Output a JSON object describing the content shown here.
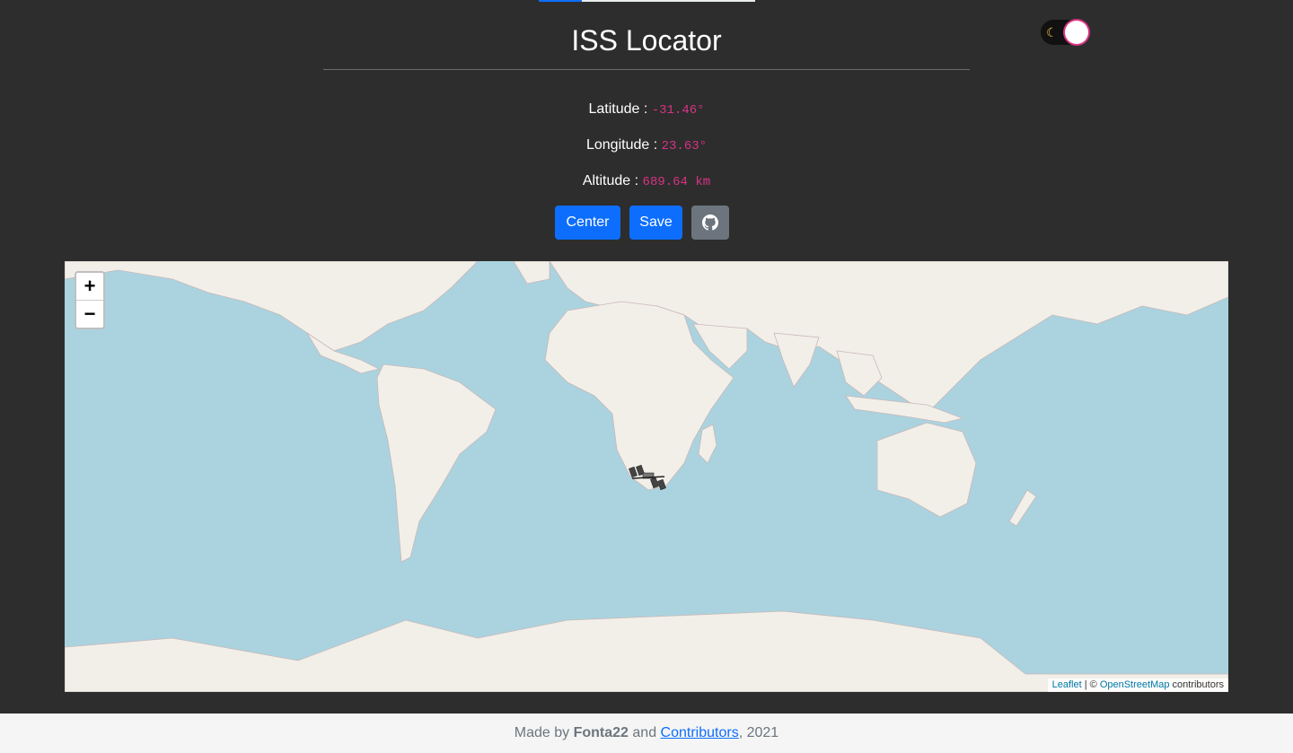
{
  "page": {
    "title": "ISS Locator",
    "theme_toggle_icon": "moon-icon",
    "progress": 0.2
  },
  "position": {
    "latitude_label": "Latitude :",
    "latitude_value": "-31.46°",
    "longitude_label": "Longitude :",
    "longitude_value": "23.63°",
    "altitude_label": "Altitude :",
    "altitude_value": "689.64 km"
  },
  "buttons": {
    "center_label": "Center",
    "save_label": "Save",
    "github_icon": "github-icon"
  },
  "map": {
    "zoom_in_label": "+",
    "zoom_out_label": "−",
    "marker_icon": "iss-icon",
    "attribution": {
      "leaflet_label": "Leaflet",
      "separator": " | © ",
      "osm_label": "OpenStreetMap",
      "suffix": " contributors"
    }
  },
  "footer": {
    "prefix": "Made by ",
    "author": "Fonta22",
    "and": " and ",
    "contributors_link": "Contributors",
    "year": ", 2021"
  },
  "colors": {
    "background": "#2d2d2d",
    "primary": "#0d6efd",
    "secondary": "#6c757d",
    "code_value": "#d63384",
    "water": "#aad3df",
    "land": "#f2efe9"
  }
}
